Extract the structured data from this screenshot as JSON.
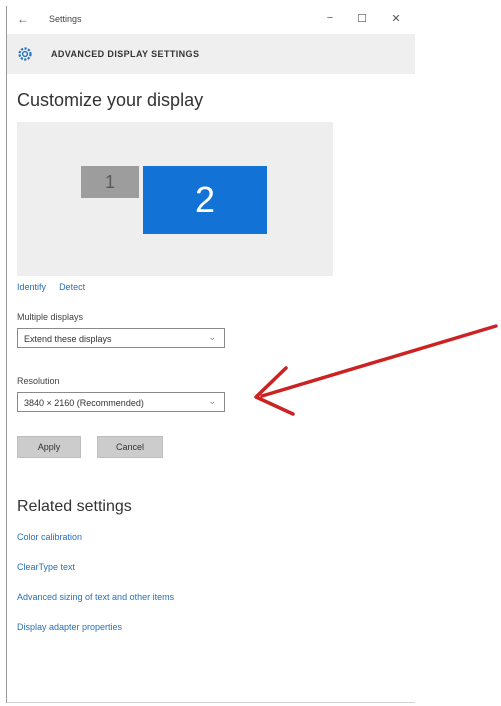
{
  "window": {
    "title": "Settings",
    "back_glyph": "←",
    "minimize_glyph": "−",
    "maximize_glyph": "☐",
    "close_glyph": "✕"
  },
  "header": {
    "icon": "gear-icon",
    "title": "ADVANCED DISPLAY SETTINGS"
  },
  "page": {
    "title": "Customize your display"
  },
  "monitors": [
    {
      "label": "1",
      "selected": false,
      "color": "#9d9d9d"
    },
    {
      "label": "2",
      "selected": true,
      "color": "#1272d6"
    }
  ],
  "monitor_links": {
    "identify": "Identify",
    "detect": "Detect"
  },
  "multiple_displays": {
    "label": "Multiple displays",
    "value": "Extend these displays"
  },
  "resolution": {
    "label": "Resolution",
    "value": "3840 × 2160 (Recommended)"
  },
  "buttons": {
    "apply": "Apply",
    "cancel": "Cancel"
  },
  "related": {
    "title": "Related settings",
    "links": [
      "Color calibration",
      "ClearType text",
      "Advanced sizing of text and other items",
      "Display adapter properties"
    ]
  },
  "colors": {
    "accent": "#1272d6",
    "link": "#2670b8",
    "arrow": "#cc2222"
  }
}
